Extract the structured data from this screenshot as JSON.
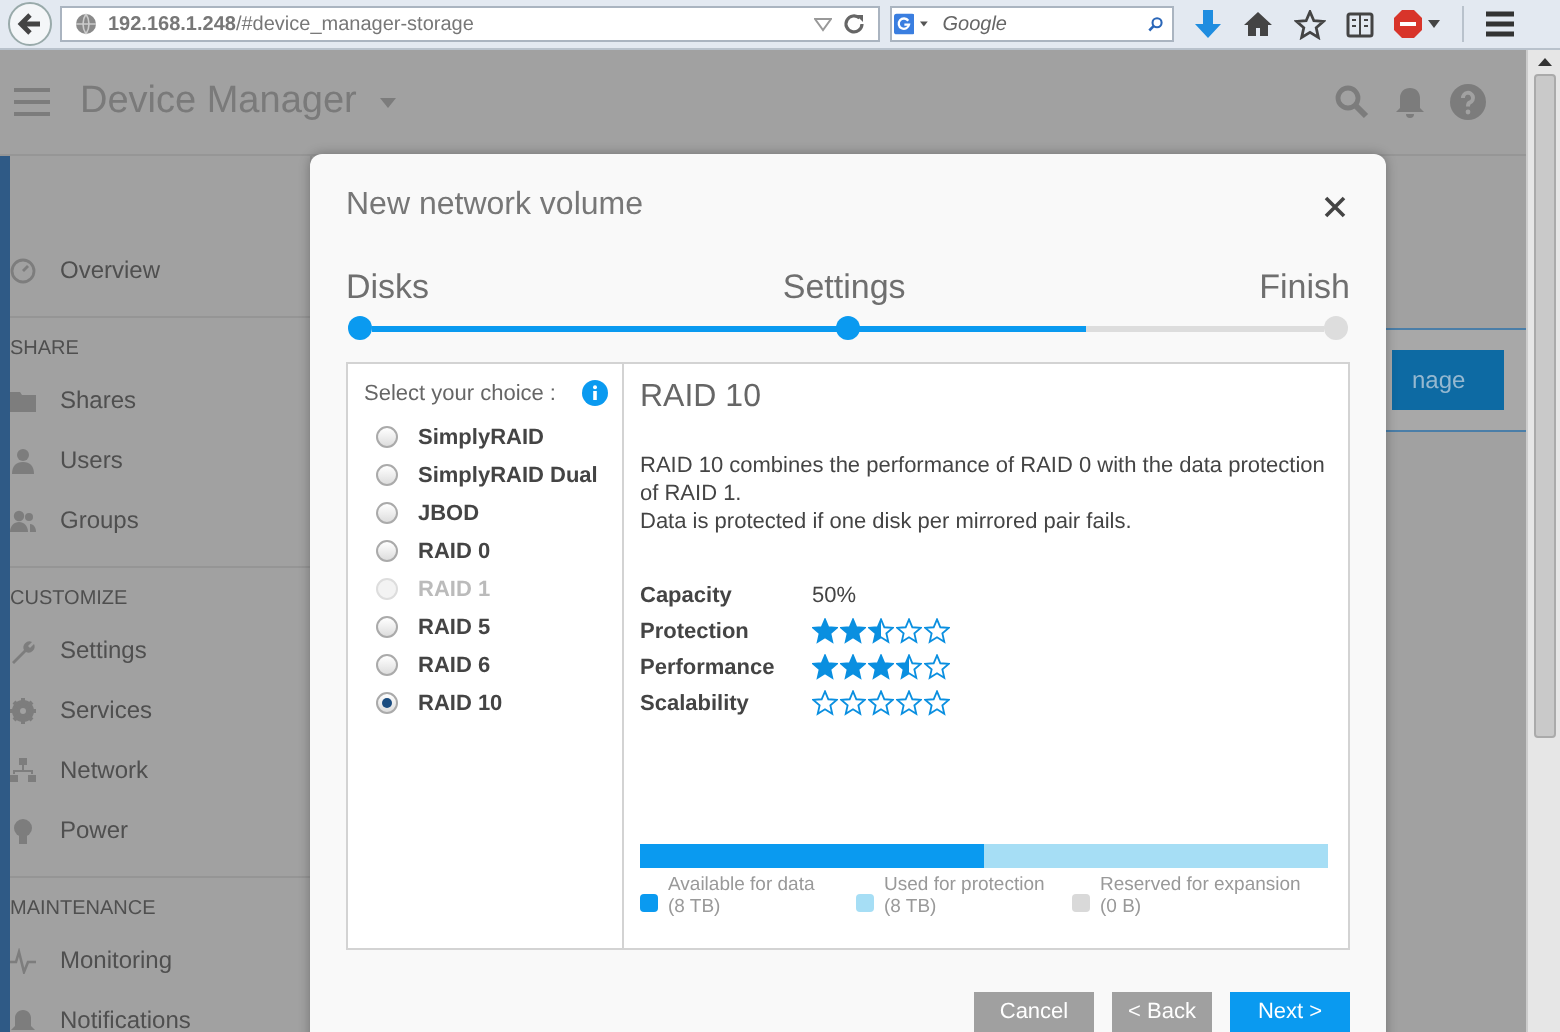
{
  "browser": {
    "url": "**192.168.1.248**/#device_manager-storage",
    "search_placeholder": "Google"
  },
  "app": {
    "title": "Device Manager"
  },
  "sidebar": {
    "sections": [
      {
        "items": [
          "Overview"
        ]
      },
      {
        "heading": "SHARE",
        "items": [
          "Shares",
          "Users",
          "Groups"
        ]
      },
      {
        "heading": "CUSTOMIZE",
        "items": [
          "Settings",
          "Services",
          "Network",
          "Power"
        ]
      },
      {
        "heading": "MAINTENANCE",
        "items": [
          "Monitoring",
          "Notifications"
        ]
      }
    ]
  },
  "background_button": {
    "label": "nage"
  },
  "dialog": {
    "title": "New network volume",
    "steps": [
      {
        "label": "Disks",
        "done": true
      },
      {
        "label": "Settings",
        "done": true
      },
      {
        "label": "Finish",
        "done": false
      }
    ],
    "progress": {
      "level": 0.75
    },
    "choice_heading": "Select your choice :",
    "options": [
      {
        "label": "SimplyRAID",
        "selected": false,
        "disabled": false
      },
      {
        "label": "SimplyRAID Dual",
        "selected": false,
        "disabled": false
      },
      {
        "label": "JBOD",
        "selected": false,
        "disabled": false
      },
      {
        "label": "RAID 0",
        "selected": false,
        "disabled": false
      },
      {
        "label": "RAID 1",
        "selected": false,
        "disabled": true
      },
      {
        "label": "RAID 5",
        "selected": false,
        "disabled": false
      },
      {
        "label": "RAID 6",
        "selected": false,
        "disabled": false
      },
      {
        "label": "RAID 10",
        "selected": true,
        "disabled": false
      }
    ],
    "detail": {
      "title": "RAID 10",
      "description": [
        "RAID 10 combines the performance of RAID 0 with the data protection of RAID 1.",
        "Data is protected if one disk per mirrored pair fails."
      ],
      "ratings": [
        {
          "label": "Capacity",
          "kind": "text",
          "value": "50%"
        },
        {
          "label": "Protection",
          "kind": "stars",
          "stars": 2.5
        },
        {
          "label": "Performance",
          "kind": "stars",
          "stars": 3.5
        },
        {
          "label": "Scalability",
          "kind": "stars",
          "stars": 0
        }
      ],
      "storage": [
        {
          "label": "Available for data",
          "amount": "(8 TB)",
          "color": "#0a9af0",
          "level": 0.5
        },
        {
          "label": "Used for protection",
          "amount": "(8 TB)",
          "color": "#a6def5",
          "level": 0.5
        },
        {
          "label": "Reserved for expansion",
          "amount": "(0 B)",
          "color": "#d9d9d9",
          "level": 0
        }
      ]
    },
    "buttons": [
      {
        "label": "Cancel",
        "kind": "secondary"
      },
      {
        "label": "< Back",
        "kind": "secondary"
      },
      {
        "label": "Next >",
        "kind": "primary"
      }
    ]
  }
}
